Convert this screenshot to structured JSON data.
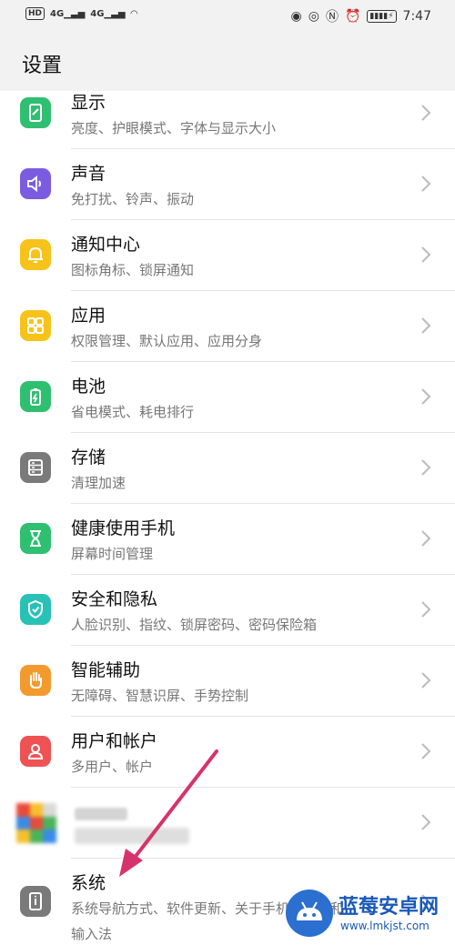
{
  "status_bar": {
    "left_icons": [
      "HD",
      "4G",
      "4G",
      "wifi-icon"
    ],
    "right_icons": [
      "eye-comfort-icon",
      "eye-icon",
      "nfc-icon",
      "alarm-icon",
      "battery-charging-icon"
    ],
    "time": "7:47"
  },
  "header": {
    "title": "设置"
  },
  "items": [
    {
      "label": "显示",
      "sub": "亮度、护眼模式、字体与显示大小",
      "icon": "display-icon",
      "color": "#2fbf71"
    },
    {
      "label": "声音",
      "sub": "免打扰、铃声、振动",
      "icon": "speaker-icon",
      "color": "#7b5ce0"
    },
    {
      "label": "通知中心",
      "sub": "图标角标、锁屏通知",
      "icon": "bell-icon",
      "color": "#f7c31a"
    },
    {
      "label": "应用",
      "sub": "权限管理、默认应用、应用分身",
      "icon": "apps-grid-icon",
      "color": "#f7c31a"
    },
    {
      "label": "电池",
      "sub": "省电模式、耗电排行",
      "icon": "battery-icon",
      "color": "#2fbf71"
    },
    {
      "label": "存储",
      "sub": "清理加速",
      "icon": "storage-icon",
      "color": "#7a7a7a"
    },
    {
      "label": "健康使用手机",
      "sub": "屏幕时间管理",
      "icon": "hourglass-icon",
      "color": "#2fbf71"
    },
    {
      "label": "安全和隐私",
      "sub": "人脸识别、指纹、锁屏密码、密码保险箱",
      "icon": "shield-icon",
      "color": "#27c2b5"
    },
    {
      "label": "智能辅助",
      "sub": "无障碍、智慧识屏、手势控制",
      "icon": "hand-icon",
      "color": "#f29a2e"
    },
    {
      "label": "用户和帐户",
      "sub": "多用户、帐户",
      "icon": "user-icon",
      "color": "#ee5253"
    }
  ],
  "blurred_item": {
    "icon": "google-icon"
  },
  "system_item": {
    "label": "系统",
    "sub": "系统导航方式、软件更新、关于手机、语言和",
    "sub2": "输入法",
    "icon": "phone-info-icon",
    "color": "#7a7a7a"
  },
  "annotation": {
    "type": "arrow",
    "color": "#d6336c"
  },
  "watermark": {
    "title": "蓝莓安卓网",
    "url": "www.lmkjst.com"
  }
}
